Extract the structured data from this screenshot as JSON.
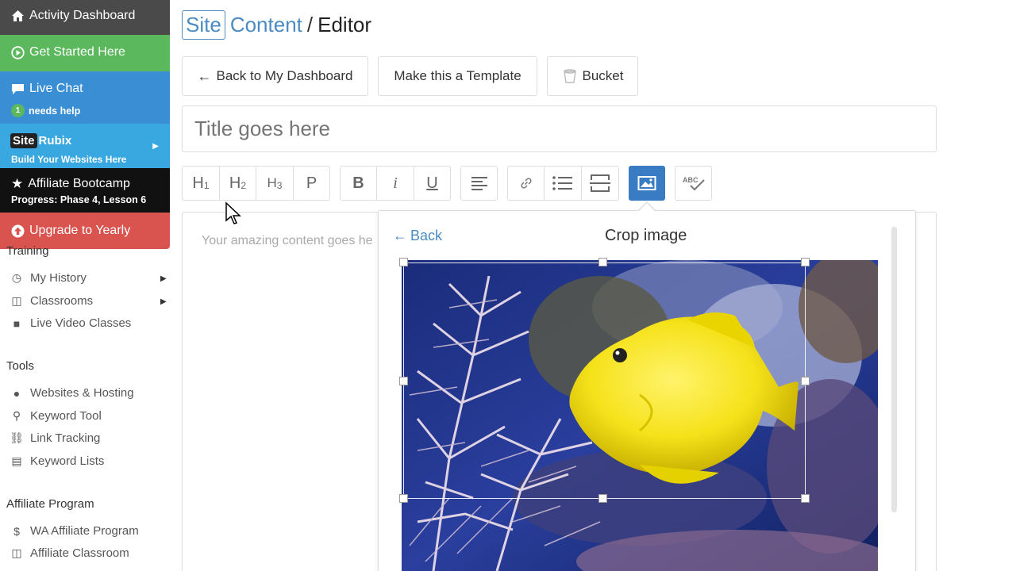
{
  "sidebar": {
    "activity_dashboard": "Activity Dashboard",
    "get_started": "Get Started Here",
    "live_chat": "Live Chat",
    "live_chat_badge": "1",
    "live_chat_status": "needs help",
    "rubix_site": "Site",
    "rubix_brand": "Rubix",
    "rubix_tagline": "Build Your Websites Here",
    "bootcamp_title": "Affiliate Bootcamp",
    "bootcamp_progress": "Progress: Phase 4, Lesson 6",
    "upgrade": "Upgrade to Yearly",
    "training_heading": "Training",
    "training_items": [
      {
        "label": "My History",
        "icon": "history-icon"
      },
      {
        "label": "Classrooms",
        "icon": "book-icon"
      },
      {
        "label": "Live Video Classes",
        "icon": "video-icon"
      }
    ],
    "tools_heading": "Tools",
    "tools_items": [
      {
        "label": "Websites & Hosting",
        "icon": "globe-icon"
      },
      {
        "label": "Keyword Tool",
        "icon": "search-icon"
      },
      {
        "label": "Link Tracking",
        "icon": "link-icon"
      },
      {
        "label": "Keyword Lists",
        "icon": "list-stack-icon"
      }
    ],
    "affiliate_heading": "Affiliate Program",
    "affiliate_items": [
      {
        "label": "WA Affiliate Program",
        "icon": "dollar-icon"
      },
      {
        "label": "Affiliate Classroom",
        "icon": "book-icon"
      }
    ]
  },
  "header": {
    "bc_site": "Site",
    "bc_content": "Content",
    "bc_sep": "/",
    "bc_editor": "Editor"
  },
  "actions": {
    "back_dashboard": "Back to My Dashboard",
    "make_template": "Make this a Template",
    "bucket": "Bucket"
  },
  "editor": {
    "title_placeholder": "Title goes here",
    "content_placeholder": "Your amazing content goes he"
  },
  "toolbar": {
    "h1": "H",
    "h1_sub": "1",
    "h2": "H",
    "h2_sub": "2",
    "h3": "H",
    "h3_sub": "3",
    "p": "P",
    "bold": "B",
    "italic": "i",
    "underline": "U",
    "spell": "ABC"
  },
  "crop_popup": {
    "back": "Back",
    "title": "Crop image"
  },
  "colors": {
    "accent": "#4a8bc2",
    "active_tool": "#3a7cc4",
    "green": "#5cb85c",
    "red": "#d9534f"
  }
}
